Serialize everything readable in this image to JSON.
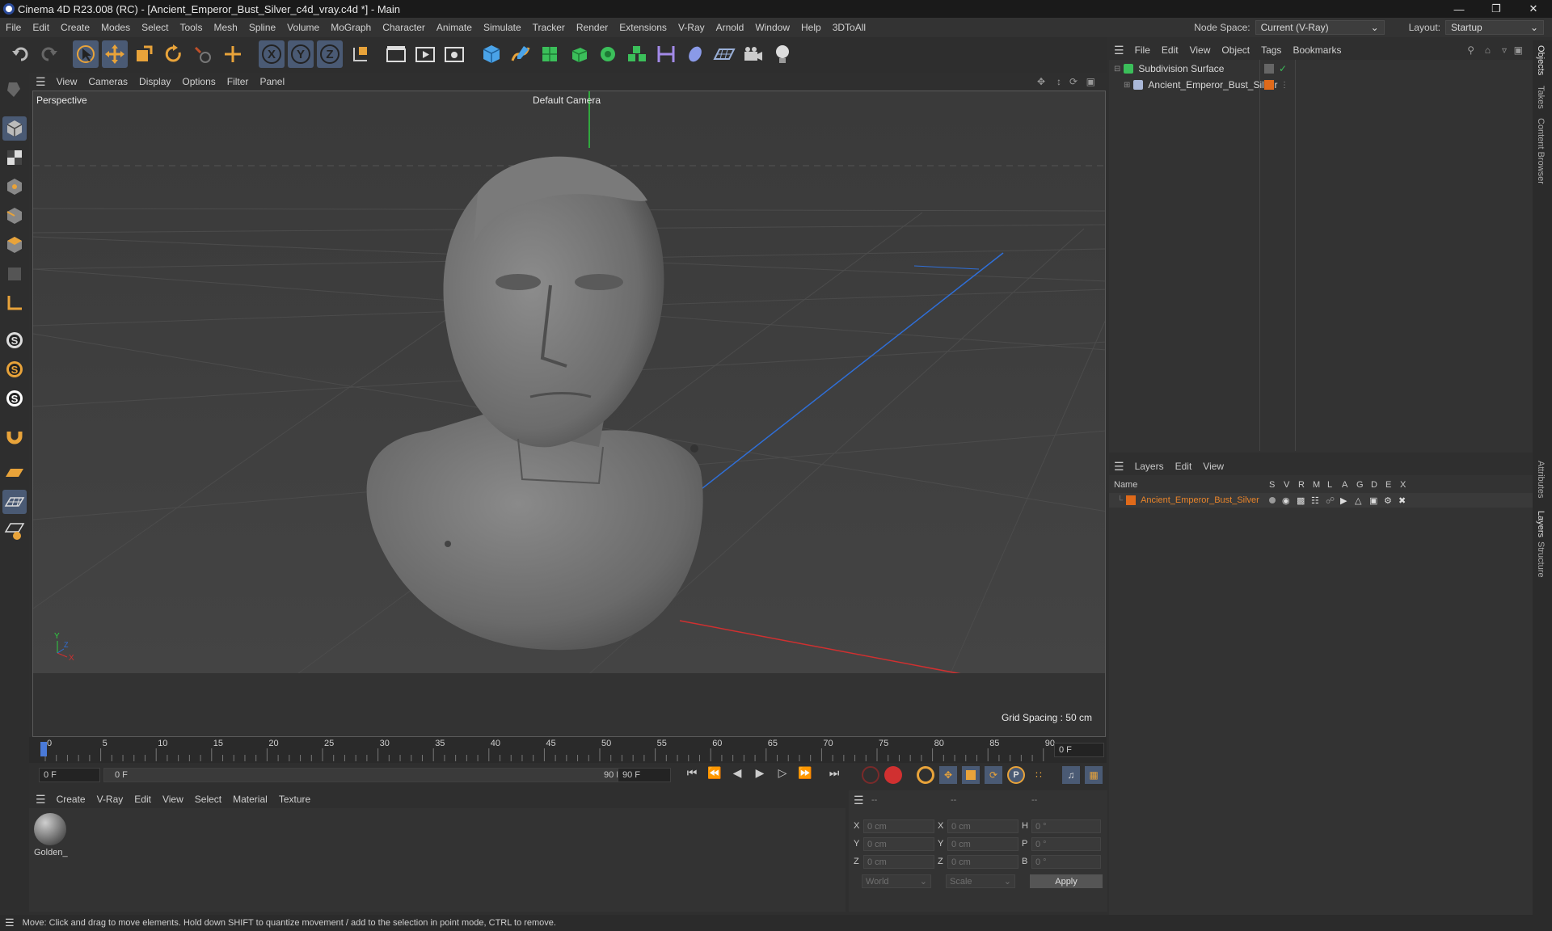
{
  "titlebar": {
    "title": "Cinema 4D R23.008 (RC) - [Ancient_Emperor_Bust_Silver_c4d_vray.c4d *] - Main"
  },
  "menu": [
    "File",
    "Edit",
    "Create",
    "Modes",
    "Select",
    "Tools",
    "Mesh",
    "Spline",
    "Volume",
    "MoGraph",
    "Character",
    "Animate",
    "Simulate",
    "Tracker",
    "Render",
    "Extensions",
    "V-Ray",
    "Arnold",
    "Window",
    "Help",
    "3DToAll"
  ],
  "nodespace": {
    "label": "Node Space:",
    "value": "Current (V-Ray)"
  },
  "layout": {
    "label": "Layout:",
    "value": "Startup"
  },
  "viewport_menu": [
    "View",
    "Cameras",
    "Display",
    "Options",
    "Filter",
    "Panel"
  ],
  "viewport": {
    "name": "Perspective",
    "camera": "Default Camera",
    "grid_spacing": "Grid Spacing : 50 cm"
  },
  "timeline": {
    "ticks": [
      "0",
      "5",
      "10",
      "15",
      "20",
      "25",
      "30",
      "35",
      "40",
      "45",
      "50",
      "55",
      "60",
      "65",
      "70",
      "75",
      "80",
      "85",
      "90"
    ],
    "current_frame": "0 F"
  },
  "transport": {
    "start": "0 F",
    "range_start": "0 F",
    "range_end": "90 F",
    "end": "90 F"
  },
  "material_menu": [
    "Create",
    "V-Ray",
    "Edit",
    "View",
    "Select",
    "Material",
    "Texture"
  ],
  "materials": [
    {
      "name": "Golden_"
    }
  ],
  "coords": {
    "headers": [
      "--",
      "--",
      "--"
    ],
    "rows": [
      {
        "l1": "X",
        "v1": "0 cm",
        "l2": "X",
        "v2": "0 cm",
        "l3": "H",
        "v3": "0 °"
      },
      {
        "l1": "Y",
        "v1": "0 cm",
        "l2": "Y",
        "v2": "0 cm",
        "l3": "P",
        "v3": "0 °"
      },
      {
        "l1": "Z",
        "v1": "0 cm",
        "l2": "Z",
        "v2": "0 cm",
        "l3": "B",
        "v3": "0 °"
      }
    ],
    "space": "World",
    "mode": "Scale",
    "apply": "Apply"
  },
  "object_menu": [
    "File",
    "Edit",
    "View",
    "Object",
    "Tags",
    "Bookmarks"
  ],
  "objects": [
    {
      "name": "Subdivision Surface"
    },
    {
      "name": "Ancient_Emperor_Bust_Silver"
    }
  ],
  "layers_menu": [
    "Layers",
    "Edit",
    "View"
  ],
  "layers_header": {
    "name": "Name",
    "cols": [
      "S",
      "V",
      "R",
      "M",
      "L",
      "A",
      "G",
      "D",
      "E",
      "X"
    ]
  },
  "layers": [
    {
      "name": "Ancient_Emperor_Bust_Silver",
      "color": "#e06a1a"
    }
  ],
  "side_tabs": [
    "Objects",
    "Takes",
    "Content Browser",
    "Attributes",
    "Layers",
    "Structure"
  ],
  "status": "Move: Click and drag to move elements. Hold down SHIFT to quantize movement / add to the selection in point mode, CTRL to remove.",
  "colors": {
    "accent": "#4a5a74",
    "layer_orange": "#e06a1a",
    "title_bg": "#1a1a1a"
  }
}
